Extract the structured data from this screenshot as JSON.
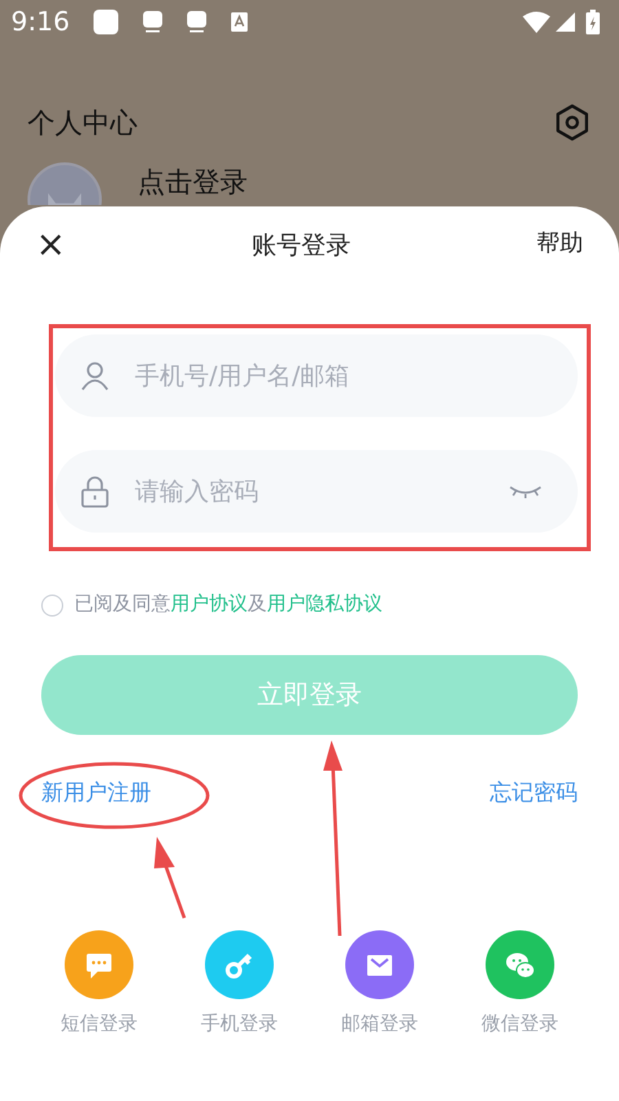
{
  "status_bar": {
    "time": "9:16"
  },
  "background_page": {
    "title": "个人中心",
    "user_label": "点击登录"
  },
  "sheet": {
    "close": "×",
    "title": "账号登录",
    "help": "帮助"
  },
  "fields": [
    {
      "kind": "user",
      "placeholder": "手机号/用户名/邮箱"
    },
    {
      "kind": "password",
      "placeholder": "请输入密码"
    }
  ],
  "agreement": {
    "checked": false,
    "parts": [
      {
        "text": "已阅及同意",
        "link": false
      },
      {
        "text": "用户协议",
        "link": true
      },
      {
        "text": "及",
        "link": false
      },
      {
        "text": "用户隐私协议",
        "link": true
      }
    ]
  },
  "login_button": {
    "label": "立即登录",
    "disabled": true
  },
  "register_link": "新用户注册",
  "forgot_link": "忘记密码",
  "alt_logins": [
    {
      "kind": "message",
      "label": "短信登录",
      "color": "#f7a21b"
    },
    {
      "kind": "key",
      "label": "手机登录",
      "color": "#1ecbf0"
    },
    {
      "kind": "mail",
      "label": "邮箱登录",
      "color": "#8b6cf6"
    },
    {
      "kind": "chat",
      "label": "微信登录",
      "color": "#1fc25f"
    }
  ]
}
